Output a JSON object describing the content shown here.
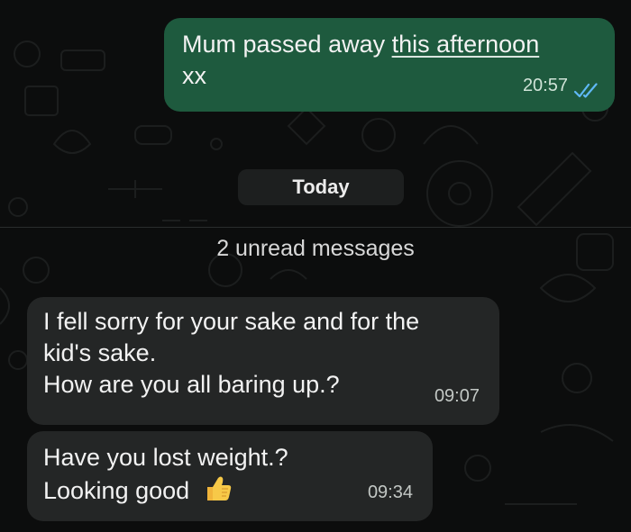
{
  "messages": [
    {
      "direction": "outgoing",
      "text_part1": "Mum passed away ",
      "text_linked": "this afternoon",
      "text_line2": "xx",
      "time": "20:57",
      "status": "read-double-tick-icon"
    },
    {
      "direction": "incoming",
      "line1": "I fell sorry for your sake and for the",
      "line2": "kid's sake.",
      "line3": "How are you all baring up.?",
      "time": "09:07"
    },
    {
      "direction": "incoming",
      "line1": "Have you lost weight.?",
      "line2": "Looking good",
      "emoji": "thumbs-up-icon",
      "time": "09:34"
    }
  ],
  "date_separator": "Today",
  "unread_banner": "2 unread messages",
  "colors": {
    "background": "#0c0d0d",
    "outgoing_bubble": "#1e5a3e",
    "incoming_bubble": "#242626",
    "read_ticks": "#5fb8f5"
  }
}
